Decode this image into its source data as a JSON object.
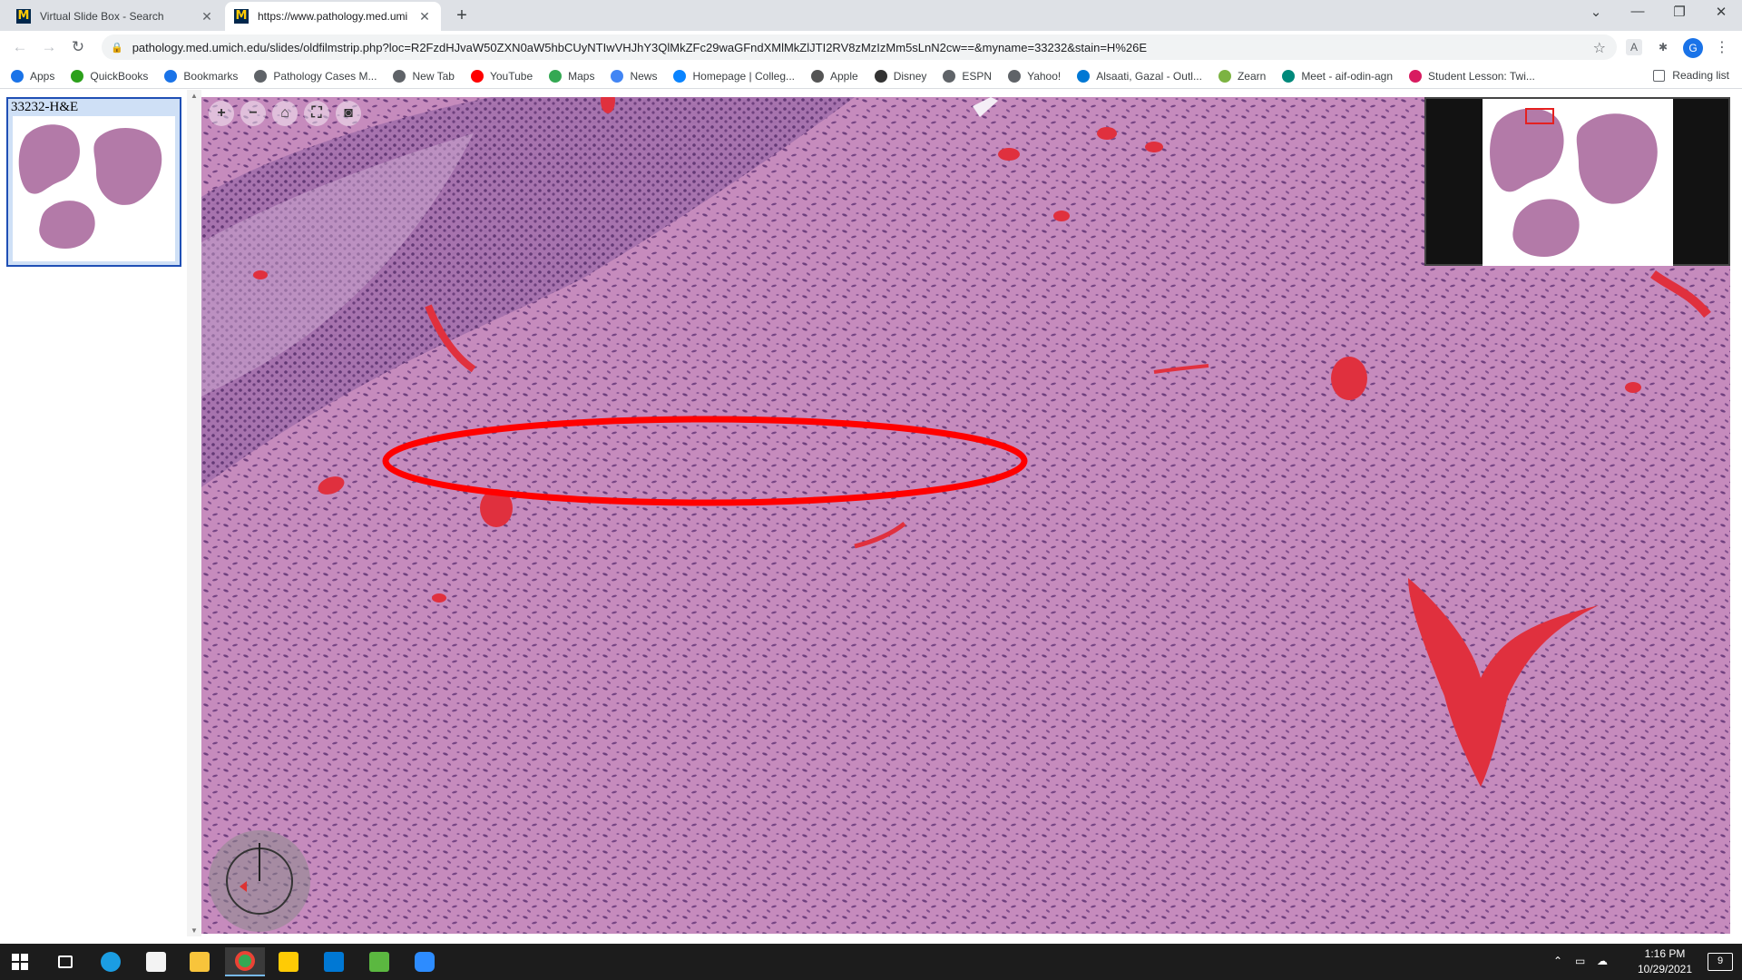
{
  "browser": {
    "tabs": [
      {
        "title": "Virtual Slide Box - Search",
        "favicon": "M"
      },
      {
        "title": "https://www.pathology.med.umi",
        "favicon": "M"
      }
    ],
    "new_tab_icon": "+",
    "window_controls": [
      "chevron-down-icon",
      "minimize-icon",
      "restore-icon",
      "close-icon"
    ],
    "url": "pathology.med.umich.edu/slides/oldfilmstrip.php?loc=R2FzdHJvaW50ZXN0aW5hbCUyNTIwVHJhY3QlMkZFc29waGFndXMlMkZlJTI2RV8zMzIzMm5sLnN2cw==&myname=33232&stain=H%26E",
    "profile_initial": "G"
  },
  "bookmarks": [
    {
      "label": "Apps",
      "icon": "apps-grid-icon",
      "color": "#1a73e8"
    },
    {
      "label": "QuickBooks",
      "icon": "quickbooks-icon",
      "color": "#2ca01c"
    },
    {
      "label": "Bookmarks",
      "icon": "star-icon",
      "color": "#1a73e8"
    },
    {
      "label": "Pathology Cases M...",
      "icon": "globe-icon",
      "color": "#5f6368"
    },
    {
      "label": "New Tab",
      "icon": "globe-icon",
      "color": "#5f6368"
    },
    {
      "label": "YouTube",
      "icon": "youtube-icon",
      "color": "#ff0000"
    },
    {
      "label": "Maps",
      "icon": "maps-pin-icon",
      "color": "#34a853"
    },
    {
      "label": "News",
      "icon": "news-icon",
      "color": "#4285f4"
    },
    {
      "label": "Homepage | Colleg...",
      "icon": "college-icon",
      "color": "#0a84ff"
    },
    {
      "label": "Apple",
      "icon": "apple-icon",
      "color": "#555555"
    },
    {
      "label": "Disney",
      "icon": "disney-icon",
      "color": "#333333"
    },
    {
      "label": "ESPN",
      "icon": "globe-icon",
      "color": "#5f6368"
    },
    {
      "label": "Yahoo!",
      "icon": "globe-icon",
      "color": "#5f6368"
    },
    {
      "label": "Alsaati, Gazal - Outl...",
      "icon": "outlook-icon",
      "color": "#0078d4"
    },
    {
      "label": "Zearn",
      "icon": "zearn-icon",
      "color": "#7cb342"
    },
    {
      "label": "Meet - aif-odin-agn",
      "icon": "meet-icon",
      "color": "#00897b"
    },
    {
      "label": "Student Lesson: Twi...",
      "icon": "t-icon",
      "color": "#d81b60"
    }
  ],
  "reading_list_label": "Reading list",
  "slide": {
    "thumbnail_label": "33232-H&E",
    "viewer_controls": [
      "zoom-in-icon",
      "zoom-out-icon",
      "home-icon",
      "fullscreen-icon",
      "camera-icon"
    ],
    "tissue_color": "#c68bbd",
    "epithelium_color": "#9a62a6",
    "vessel_color": "#e0303e",
    "annotation_color": "#ff0000"
  },
  "taskbar": {
    "time": "1:16 PM",
    "date": "10/29/2021",
    "notification_count": "9"
  }
}
